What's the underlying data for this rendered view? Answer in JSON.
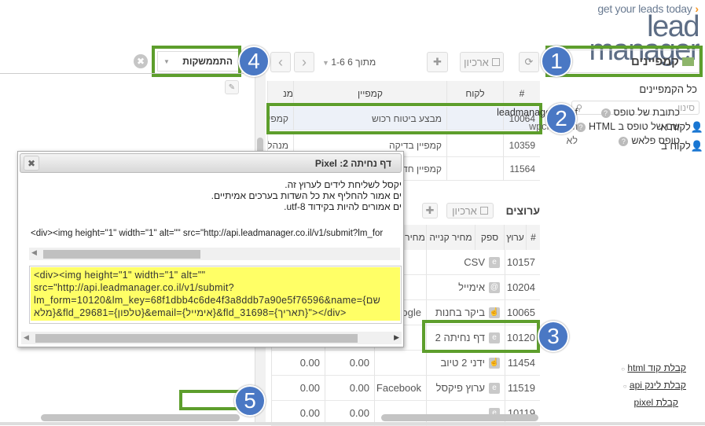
{
  "logo": {
    "tagline": "get your leads today",
    "name": "lead manager",
    "accent": "#f7941d"
  },
  "colors": {
    "highlight": "#5d9e2c",
    "badge": "#4a78c4",
    "selected_row": "#edf1f8",
    "code_bg": "#ffff66"
  },
  "badges": [
    "1",
    "2",
    "3",
    "4",
    "5"
  ],
  "sidebar": {
    "dropdown_label": "קמפיינים",
    "all_label": "כל הקמפיינים",
    "search_placeholder": "סינון",
    "clients": [
      "לקוח א",
      "לקוח ב"
    ]
  },
  "campaigns": {
    "archive_label": "ארכיון",
    "pagination": "1-6 מתוך 6",
    "columns": [
      "#",
      "לקוח",
      "קמפיין",
      "מנ"
    ],
    "rows": [
      {
        "id": "10064",
        "client": "",
        "name": "מבצע ביטוח רכוש",
        "manager": "קמפי",
        "selected": true
      },
      {
        "id": "10359",
        "client": "",
        "name": "קמפיין בדיקה",
        "manager": "מנהל"
      },
      {
        "id": "11564",
        "client": "",
        "name": "קמפיין חדש",
        "manager": ""
      }
    ]
  },
  "channels": {
    "title": "ערוצים",
    "archive_label": "ארכיון",
    "columns": [
      "#",
      "ערוץ",
      "ספק",
      "מחיר קנייה",
      "מחיר"
    ],
    "rows": [
      {
        "id": "10157",
        "icon": "e",
        "name": "CSV",
        "supplier": "",
        "buy": "",
        "sell": ""
      },
      {
        "id": "10204",
        "icon": "@",
        "name": "אימייל",
        "supplier": "",
        "buy": "",
        "sell": ""
      },
      {
        "id": "10065",
        "icon": "hand",
        "name": "ביקר בחנות",
        "supplier": "Google",
        "buy": "",
        "sell": ""
      },
      {
        "id": "10120",
        "icon": "e",
        "name": "דף נחיתה 2",
        "supplier": "",
        "buy": "",
        "sell": ""
      },
      {
        "id": "11454",
        "icon": "hand",
        "name": "ידני 2 טיוב",
        "supplier": "",
        "buy": "0.00",
        "sell": "0.00"
      },
      {
        "id": "11519",
        "icon": "e",
        "name": "ערוץ פיקסל",
        "supplier": "Facebook",
        "buy": "0.00",
        "sell": "0.00"
      },
      {
        "id": "10119",
        "icon": "e",
        "name": "",
        "supplier": "",
        "buy": "0.00",
        "sell": "0.00"
      }
    ]
  },
  "details": {
    "tab_label": "התממשקות",
    "props": [
      {
        "label": "כתובת של טופס",
        "value": "leadmanager.co.nf",
        "link": true
      },
      {
        "label": "שם של טופס ב HTML",
        "value": "wpcf7-form"
      },
      {
        "label": "טופס פלאש",
        "value": "לא"
      }
    ],
    "links": [
      "קבלת קוד html",
      "קבלת לינק api",
      "קבלת pixel"
    ]
  },
  "dialog": {
    "title": "דף נחיתה 2: Pixel",
    "lines": [
      "יקסל לשליחת לידים לערוץ זה.",
      "ים אמור להחליף את כל השדות בערכים אמיתיים.",
      "ים אמורים להיות בקידוד utf-8."
    ],
    "code_line": "<div><img height=\"1\" width=\"1\" alt=\"\" src=\"http://api.leadmanager.co.il/v1/submit?lm_for",
    "code_box": [
      "<div><img height=\"1\" width=\"1\" alt=\"\"",
      "src=\"http://api.leadmanager.co.il/v1/submit?",
      "lm_form=10120&lm_key=68f1dbb4c6de4f3a8ddb7a90e5f76596&name={שם",
      "מלא}&fld_29681={טלפון}&email={אימייל}&fld_31698={תאריך}\"></div>"
    ]
  }
}
